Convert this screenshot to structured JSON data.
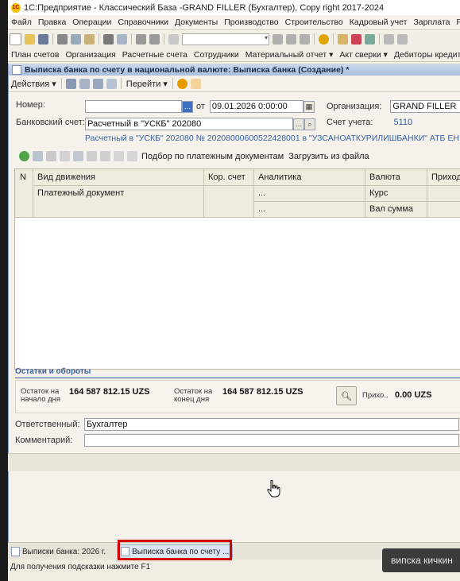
{
  "window": {
    "title": "1С:Предприятие - Классический База -GRAND FILLER (Бухгалтер),  Copy right 2017-2024"
  },
  "menu": [
    "Файл",
    "Правка",
    "Операции",
    "Справочники",
    "Документы",
    "Производство",
    "Строительство",
    "Кадровый учет",
    "Зарплата",
    "Ре"
  ],
  "quickbar": [
    "План счетов",
    "Организация",
    "Расчетные счета",
    "Сотрудники",
    "Материальный отчет ▾",
    "Акт сверки ▾",
    "Дебиторы кредиторы ▾"
  ],
  "document": {
    "title": "Выписка банка по счету в национальной валюте: Выписка банка (Создание) *",
    "toolbar": {
      "actions": "Действия ▾",
      "goto": "Перейти ▾"
    },
    "number_label": "Номер:",
    "number_value": "",
    "date_label": "от",
    "date_value": "09.01.2026  0:00:00",
    "org_label": "Организация:",
    "org_value": "GRAND FILLER",
    "bank_label": "Банковский счет:",
    "bank_value": "Расчетный в \"УСКБ\" 202080",
    "acc_label": "Счет учета:",
    "acc_value": "5110",
    "bank_link": "Расчетный в \"УСКБ\" 202080 № 20208000600522428001 в \"УЗСАНОАТКУРИЛИШБАНКИ\" АТБ ЕН",
    "grid_toolbar": {
      "pick": "Подбор по платежным документам",
      "load": "Загрузить из файла"
    },
    "grid": {
      "headers": {
        "n": "N",
        "movement": "Вид движения",
        "corr": "Кор. счет",
        "analytics": "Аналитика",
        "currency": "Валюта",
        "income": "Приход"
      },
      "subheaders": {
        "paydoc": "Платежный документ",
        "dots1": "...",
        "rate": "Курс",
        "dots2": "...",
        "valsum": "Вал сумма"
      }
    },
    "balances": {
      "section_title": "Остатки и обороты",
      "start_label_1": "Остаток на",
      "start_label_2": "начало дня",
      "start_value": "164 587 812.15 UZS",
      "end_label_1": "Остаток на",
      "end_label_2": "конец дня",
      "end_value": "164 587 812.15 UZS",
      "income_label": "Прихо..",
      "income_value": "0.00 UZS"
    },
    "responsible_label": "Ответственный:",
    "responsible_value": "Бухгалтер",
    "comment_label": "Комментарий:",
    "comment_value": ""
  },
  "taskbar": {
    "item1": "Выписки банка: 2026 г.",
    "item2": "Выписка банка по счету ..."
  },
  "statusbar": {
    "hint": "Для получения подсказки нажмите F1"
  },
  "overlay": {
    "text": "випска кичкин"
  },
  "colors": {
    "accent_link": "#3a5fa0",
    "highlight": "#d40000"
  }
}
